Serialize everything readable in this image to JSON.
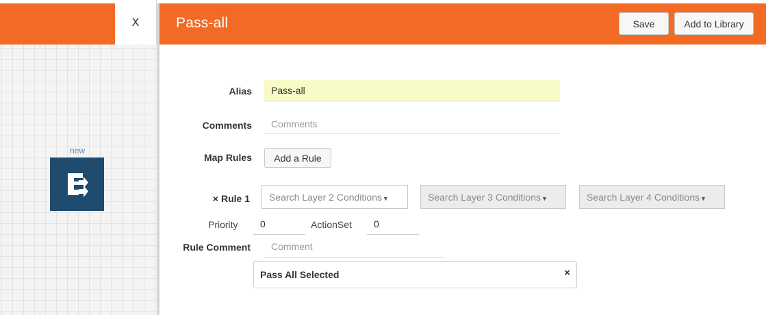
{
  "canvas": {
    "close_label": "X",
    "node": {
      "label": "new",
      "icon": "export-e-icon"
    }
  },
  "header": {
    "title": "Pass-all",
    "save_label": "Save",
    "add_library_label": "Add to Library",
    "accent_color": "#f26a24"
  },
  "form": {
    "alias": {
      "label": "Alias",
      "value": "Pass-all"
    },
    "comments": {
      "label": "Comments",
      "placeholder": "Comments"
    },
    "map_rules": {
      "label": "Map Rules",
      "button": "Add a Rule"
    },
    "rule": {
      "label": "Rule 1",
      "remove_icon": "×",
      "layer2_placeholder": "Search Layer 2 Conditions",
      "layer3_placeholder": "Search Layer 3 Conditions",
      "layer4_placeholder": "Search Layer 4 Conditions",
      "priority_label": "Priority",
      "priority_value": "0",
      "actionset_label": "ActionSet",
      "actionset_value": "0",
      "comment_label": "Rule Comment",
      "comment_placeholder": "Comment"
    },
    "selected_panel": {
      "text": "Pass All Selected",
      "close": "×"
    }
  }
}
